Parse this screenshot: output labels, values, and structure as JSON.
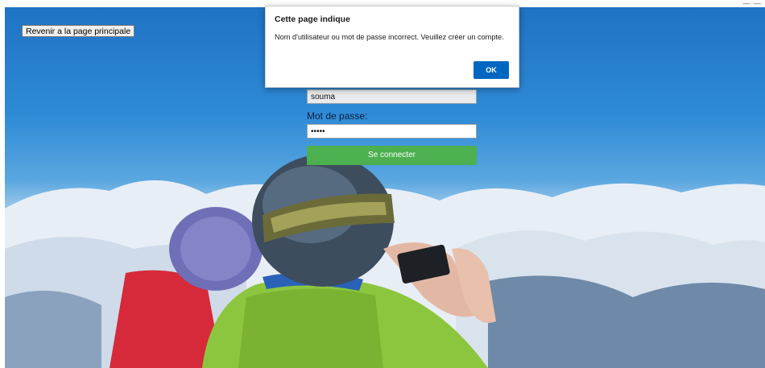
{
  "page": {
    "back_button_label": "Revenir a la page principale"
  },
  "login_form": {
    "username_value": "souma",
    "password_label": "Mot de passe:",
    "password_value": "•••••",
    "submit_label": "Se connecter"
  },
  "alert_dialog": {
    "title": "Cette page indique",
    "message": "Nom d'utilisateur ou mot de passe incorrect. Veuillez créer un compte.",
    "ok_label": "OK"
  },
  "colors": {
    "submit_button": "#4caf50",
    "ok_button": "#0067c0",
    "sky_top": "#1f73c4"
  },
  "icons": {
    "window_controls": "minimize-dashes"
  }
}
